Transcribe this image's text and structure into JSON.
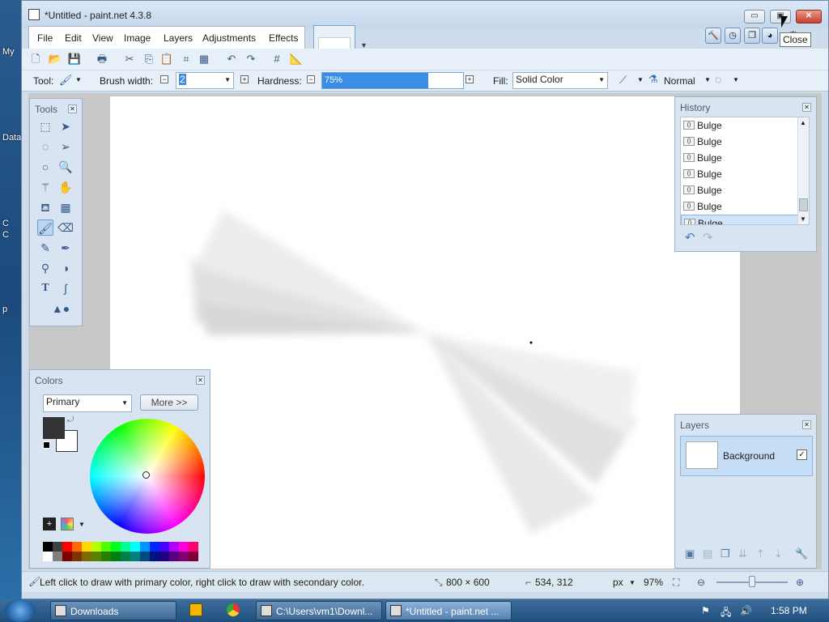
{
  "window": {
    "title": "*Untitled - paint.net 4.3.8",
    "tooltip": "Close",
    "min": "▭",
    "max": "▣",
    "close": "✕"
  },
  "desktop": {
    "icons": [
      "My",
      "Data",
      "C",
      "C",
      "p"
    ]
  },
  "menu": [
    "File",
    "Edit",
    "View",
    "Image",
    "Layers",
    "Adjustments",
    "Effects"
  ],
  "options": {
    "tool_label": "Tool:",
    "brush_width_label": "Brush width:",
    "brush_width_value": "2",
    "hardness_label": "Hardness:",
    "hardness_value": "75%",
    "hardness_fraction": 0.75,
    "fill_label": "Fill:",
    "fill_value": "Solid Color",
    "blend_value": "Normal"
  },
  "tools_panel": {
    "title": "Tools"
  },
  "history": {
    "title": "History",
    "items": [
      "Bulge",
      "Bulge",
      "Bulge",
      "Bulge",
      "Bulge",
      "Bulge",
      "Bulge"
    ],
    "selected_index": 6
  },
  "colors": {
    "title": "Colors",
    "mode": "Primary",
    "more_label": "More >>",
    "primary": "#333333",
    "secondary": "#ffffff"
  },
  "layers": {
    "title": "Layers",
    "items": [
      {
        "name": "Background",
        "visible": true
      }
    ]
  },
  "status": {
    "hint": "Left click to draw with primary color, right click to draw with secondary color.",
    "size": "800 × 600",
    "cursor": "534, 312",
    "unit": "px",
    "zoom": "97%"
  },
  "taskbar": {
    "items": [
      "Downloads",
      "C:\\Users\\vm1\\Downl...",
      "*Untitled - paint.net ..."
    ],
    "clock": "1:58 PM"
  }
}
